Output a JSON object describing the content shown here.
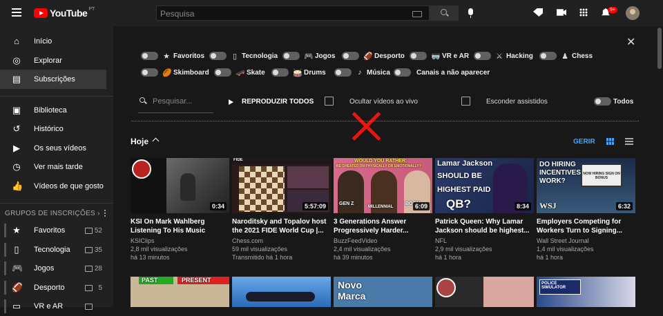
{
  "header": {
    "logo_text": "YouTube",
    "country_code": "PT",
    "search_placeholder": "Pesquisa",
    "notifications_badge": "9+"
  },
  "sidebar": {
    "main_items": [
      {
        "label": "Início",
        "icon": "home-icon"
      },
      {
        "label": "Explorar",
        "icon": "compass-icon"
      },
      {
        "label": "Subscrições",
        "icon": "subscriptions-icon"
      }
    ],
    "library_items": [
      {
        "label": "Biblioteca",
        "icon": "library-icon"
      },
      {
        "label": "Histórico",
        "icon": "history-icon"
      },
      {
        "label": "Os seus vídeos",
        "icon": "your-videos-icon"
      },
      {
        "label": "Ver mais tarde",
        "icon": "clock-icon"
      },
      {
        "label": "Vídeos de que gosto",
        "icon": "thumbs-up-icon"
      }
    ],
    "groups_header": "GRUPOS DE INSCRIÇÕES",
    "groups": [
      {
        "label": "Favoritos",
        "count": "52",
        "icon": "star-icon"
      },
      {
        "label": "Tecnologia",
        "count": "35",
        "icon": "phone-icon"
      },
      {
        "label": "Jogos",
        "count": "28",
        "icon": "gamepad-icon"
      },
      {
        "label": "Desporto",
        "count": "5",
        "icon": "football-icon"
      },
      {
        "label": "VR e AR",
        "count": "",
        "icon": "vr-icon"
      }
    ]
  },
  "filters": {
    "groups_row1": [
      {
        "label": "Favoritos",
        "icon": "★"
      },
      {
        "label": "Tecnologia",
        "icon": "▯"
      },
      {
        "label": "Jogos",
        "icon": "🎮"
      },
      {
        "label": "Desporto",
        "icon": "🏈"
      },
      {
        "label": "VR e AR",
        "icon": "🥽"
      },
      {
        "label": "Hacking",
        "icon": "⚔"
      },
      {
        "label": "Chess",
        "icon": "♟"
      }
    ],
    "groups_row2": [
      {
        "label": "Skimboard",
        "icon": "🏉"
      },
      {
        "label": "Skate",
        "icon": "🛹"
      },
      {
        "label": "Drums",
        "icon": "🥁"
      },
      {
        "label": "Música",
        "icon": "♪"
      },
      {
        "label": "Canais a não aparecer",
        "icon": ""
      }
    ],
    "search_placeholder": "Pesquisar...",
    "play_all": "REPRODUZIR TODOS",
    "hide_live": "Ocultar vídeos ao vivo",
    "hide_watched": "Esconder assistidos",
    "all_toggle": "Todos"
  },
  "section": {
    "title": "Hoje",
    "manage": "GERIR"
  },
  "videos": [
    {
      "title": "KSI On Mark Wahlberg Listening To His Music",
      "channel": "KSIClips",
      "views": "2,8 mil visualizações",
      "time": "há 13 minutos",
      "duration": "0:34"
    },
    {
      "title": "Naroditsky and Topalov host the 2021 FIDE World Cup |...",
      "channel": "Chess.com",
      "views": "59 mil visualizações",
      "time": "Transmitido há 1 hora",
      "duration": "5:57:09"
    },
    {
      "title": "3 Generations Answer Progressively Harder...",
      "channel": "BuzzFeedVideo",
      "views": "2,4 mil visualizações",
      "time": "há 39 minutos",
      "duration": "6:09"
    },
    {
      "title": "Patrick Queen: Why Lamar Jackson should be highest...",
      "channel": "NFL",
      "views": "2,9 mil visualizações",
      "time": "há 1 hora",
      "duration": "8:34"
    },
    {
      "title": "Employers Competing for Workers Turn to Signing...",
      "channel": "Wall Street Journal",
      "views": "1,4 mil visualizações",
      "time": "há 1 hora",
      "duration": "6:32"
    }
  ],
  "thumb_text": {
    "v2_header": "FIDE",
    "v3_top": "WOULD YOU RATHER:",
    "v3_sub": "BE CHEATED ON PHYSICALLY OR EMOTIONALLY?",
    "v3_l1": "GEN Z",
    "v3_l2": "MILLENNIAL",
    "v3_l3": "BOOM",
    "v4_l1": "Lamar Jackson",
    "v4_l2": "SHOULD BE",
    "v4_l3": "HIGHEST PAID",
    "v4_l4": "QB?",
    "v5_l1": "DO HIRING",
    "v5_l2": "INCENTIVES",
    "v5_l3": "WORK?",
    "v5_logo": "WSJ",
    "v5_sign": "NOW HIRING SIGN ON BONUS",
    "r2_past": "PAST",
    "r2_present": "PRESENT",
    "r2_novo": "Novo",
    "r2_marca": "Marca",
    "r2_police": "POLICE SIMULATOR"
  }
}
